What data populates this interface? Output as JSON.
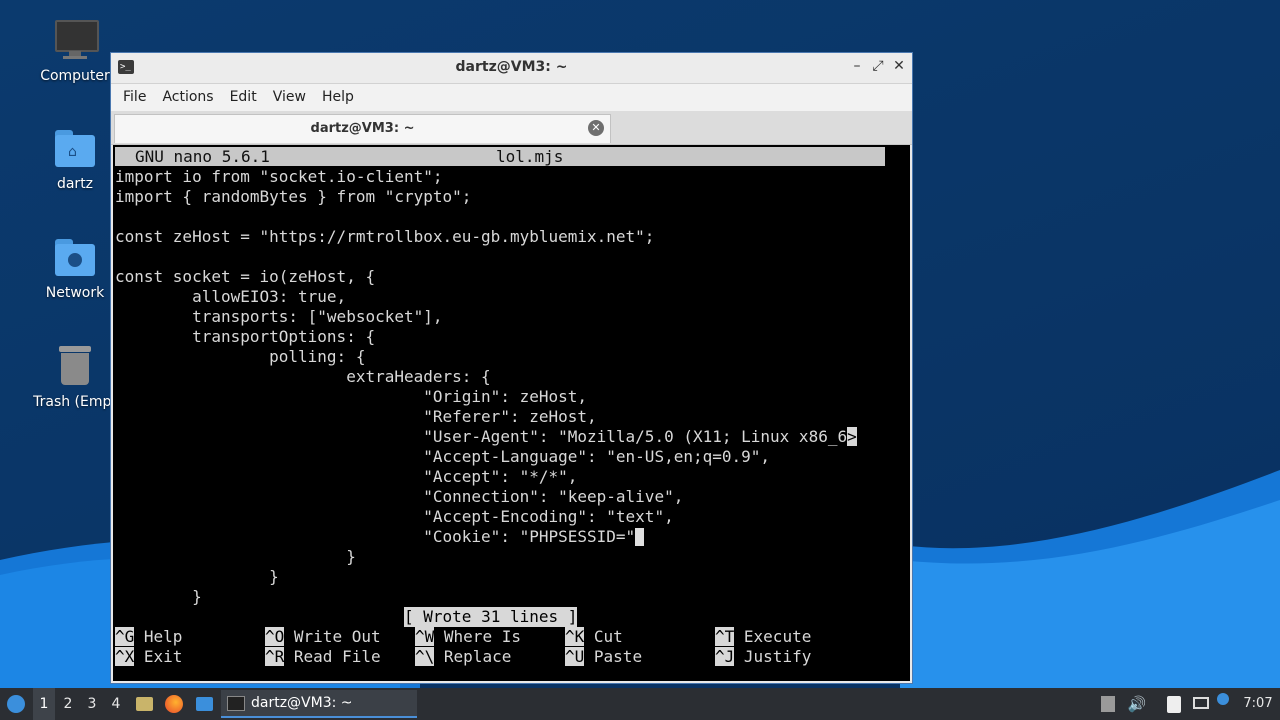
{
  "desktop": {
    "icons": [
      {
        "label": "Computer",
        "icon": "monitor-icon"
      },
      {
        "label": "dartz",
        "icon": "home-folder-icon"
      },
      {
        "label": "Network",
        "icon": "network-folder-icon"
      },
      {
        "label": "Trash (Empt",
        "icon": "trash-icon"
      }
    ],
    "accent": "#1e7fe0"
  },
  "window": {
    "title": "dartz@VM3: ~",
    "controls": {
      "minimize": "–",
      "maximize": "⤢",
      "close": "✕"
    },
    "menu": [
      "File",
      "Actions",
      "Edit",
      "View",
      "Help"
    ],
    "tab": {
      "label": "dartz@VM3: ~",
      "close": "✕"
    }
  },
  "nano": {
    "version": "GNU nano 5.6.1",
    "filename": "lol.mjs",
    "lines": [
      "import io from \"socket.io-client\";",
      "import { randomBytes } from \"crypto\";",
      "",
      "const zeHost = \"https://rmtrollbox.eu-gb.mybluemix.net\";",
      "",
      "const socket = io(zeHost, {",
      "        allowEIO3: true,",
      "        transports: [\"websocket\"],",
      "        transportOptions: {",
      "                polling: {",
      "                        extraHeaders: {",
      "                                \"Origin\": zeHost,",
      "                                \"Referer\": zeHost,",
      "                                \"User-Agent\": \"Mozilla/5.0 (X11; Linux x86_6",
      "                                \"Accept-Language\": \"en-US,en;q=0.9\",",
      "                                \"Accept\": \"*/*\",",
      "                                \"Connection\": \"keep-alive\",",
      "                                \"Accept-Encoding\": \"text\",",
      "                                \"Cookie\": \"PHPSESSID=\"",
      "                        }",
      "                }",
      "        }"
    ],
    "overflow_marker": ">",
    "status": "[ Wrote 31 lines ]",
    "shortcuts_row1": [
      {
        "key": "^G",
        "label": "Help"
      },
      {
        "key": "^O",
        "label": "Write Out"
      },
      {
        "key": "^W",
        "label": "Where Is"
      },
      {
        "key": "^K",
        "label": "Cut"
      },
      {
        "key": "^T",
        "label": "Execute"
      }
    ],
    "shortcuts_row2": [
      {
        "key": "^X",
        "label": "Exit"
      },
      {
        "key": "^R",
        "label": "Read File"
      },
      {
        "key": "^\\",
        "label": "Replace"
      },
      {
        "key": "^U",
        "label": "Paste"
      },
      {
        "key": "^J",
        "label": "Justify"
      }
    ]
  },
  "taskbar": {
    "workspaces": [
      "1",
      "2",
      "3",
      "4"
    ],
    "active_workspace": "1",
    "app_button": "dartz@VM3: ~",
    "clock": "7:07"
  }
}
